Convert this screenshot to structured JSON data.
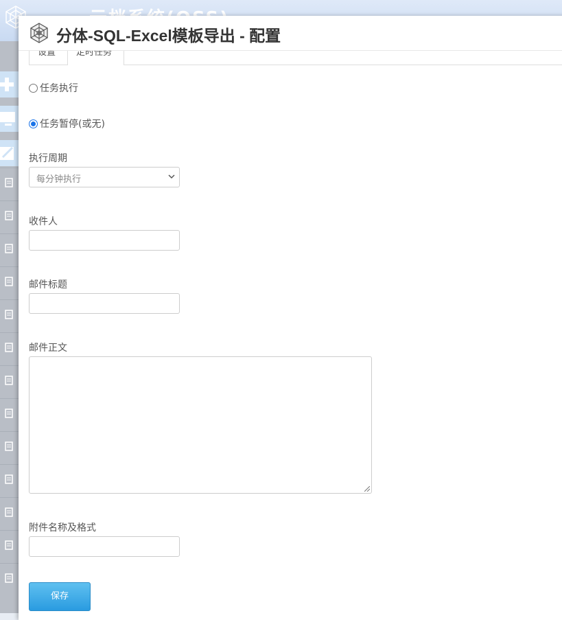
{
  "background": {
    "app_title": "云档系统(OSS)"
  },
  "dialog": {
    "title": "分体-SQL-Excel模板导出 - 配置"
  },
  "tabs": [
    {
      "label": "设置"
    },
    {
      "label": "定时任务"
    }
  ],
  "task": {
    "option_run": "任务执行",
    "option_pause": "任务暂停(或无)",
    "selected": "pause"
  },
  "form": {
    "period_label": "执行周期",
    "period_value": "每分钟执行",
    "recipient_label": "收件人",
    "recipient_value": "",
    "subject_label": "邮件标题",
    "subject_value": "",
    "body_label": "邮件正文",
    "body_value": "",
    "attachment_label": "附件名称及格式",
    "attachment_value": ""
  },
  "save_label": "保存",
  "colors": {
    "accent": "#2a9be0",
    "radio_checked": "#1a73e8"
  }
}
